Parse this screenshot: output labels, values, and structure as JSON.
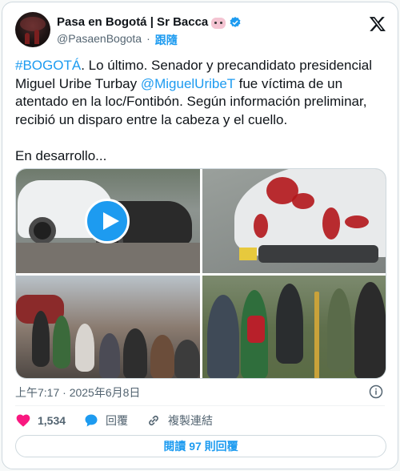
{
  "account": {
    "name": "Pasa en Bogotá | Sr Bacca",
    "handle": "@PasaenBogota",
    "follow_label": "跟隨",
    "avatar_icon": "avatar-image",
    "verified_icon": "verified-badge-icon",
    "name_emoji_icon": "pig-face-emoji"
  },
  "brand": {
    "logo_icon": "x-logo-icon"
  },
  "tweet": {
    "hashtag": "#BOGOTÁ",
    "text_part1": ". Lo último. Senador y precandidato presidencial Miguel Uribe Turbay ",
    "mention": "@MiguelUribeT",
    "text_part2": " fue víctima de un atentado en la loc/Fontibón. Según información preliminar, recibió un disparo entre la cabeza y el cuello.",
    "text_part3": "\n\nEn desarrollo..."
  },
  "media": {
    "items": [
      {
        "name": "photo-street-motorcycle",
        "has_video": true
      },
      {
        "name": "photo-blood-on-car-hood",
        "has_video": false
      },
      {
        "name": "photo-crowd-street",
        "has_video": false
      },
      {
        "name": "photo-police-crowd",
        "has_video": false
      }
    ],
    "play_icon": "play-icon"
  },
  "meta": {
    "time": "上午7:17 · 2025年6月8日",
    "info_icon": "info-icon"
  },
  "actions": {
    "like_count": "1,534",
    "reply_label": "回覆",
    "copy_link_label": "複製連結"
  },
  "replies_button": {
    "label": "閱讀 97 則回覆"
  },
  "colors": {
    "accent": "#1d9bf0",
    "like": "#f91880",
    "text": "#0f1419",
    "muted": "#536471"
  }
}
